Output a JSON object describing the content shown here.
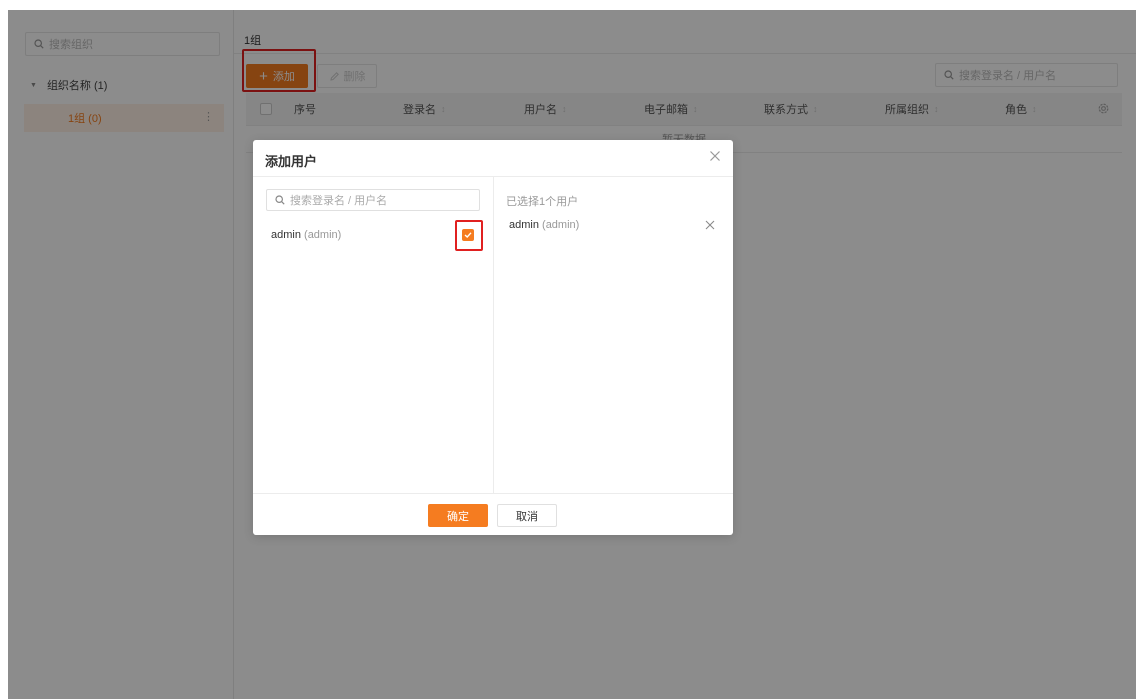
{
  "sidebar": {
    "search_placeholder": "搜索组织",
    "tree_root": "组织名称 (1)",
    "tree_child": "1组 (0)"
  },
  "main": {
    "title": "1组",
    "add_label": "添加",
    "delete_label": "删除",
    "search_placeholder": "搜索登录名 / 用户名",
    "columns": [
      {
        "label": "序号",
        "sortable": false
      },
      {
        "label": "登录名",
        "sortable": true
      },
      {
        "label": "用户名",
        "sortable": true
      },
      {
        "label": "电子邮箱",
        "sortable": true
      },
      {
        "label": "联系方式",
        "sortable": true
      },
      {
        "label": "所属组织",
        "sortable": true
      },
      {
        "label": "角色",
        "sortable": true
      }
    ],
    "empty_text": "暂无数据"
  },
  "modal": {
    "title": "添加用户",
    "search_placeholder": "搜索登录名 / 用户名",
    "users": [
      {
        "name": "admin",
        "login": "(admin)",
        "checked": true
      }
    ],
    "selected_count": "已选择1个用户",
    "selected": [
      {
        "name": "admin",
        "login": "(admin)"
      }
    ],
    "ok_label": "确定",
    "cancel_label": "取消"
  },
  "colors": {
    "accent": "#f57c20",
    "highlight": "#e02020",
    "overlay": "rgba(0,0,0,0.45)"
  },
  "icons": [
    "search-icon",
    "caret-down-icon",
    "more-icon",
    "plus-icon",
    "edit-icon",
    "sort-icon",
    "gear-icon",
    "close-icon",
    "check-icon"
  ]
}
